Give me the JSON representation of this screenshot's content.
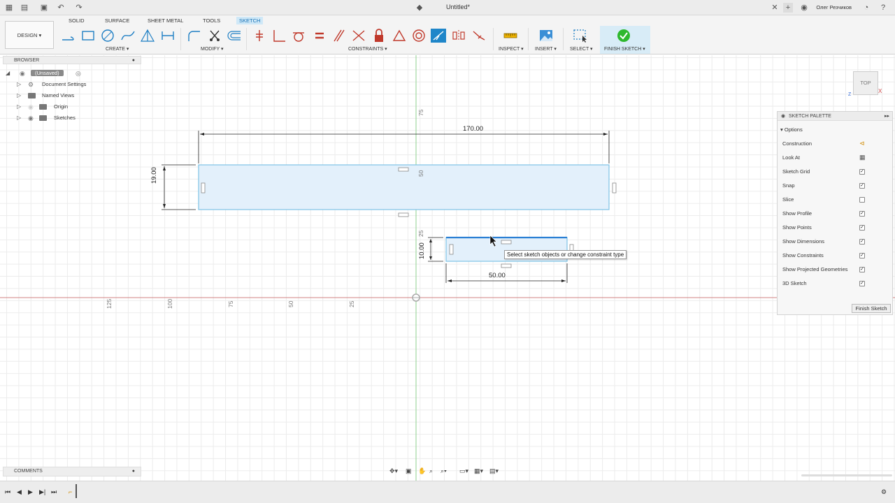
{
  "window": {
    "title": "Untitled*",
    "user": "Олег Резчиков"
  },
  "ribbon": {
    "design_label": "DESIGN",
    "tabs": [
      "SOLID",
      "SURFACE",
      "SHEET METAL",
      "TOOLS",
      "SKETCH"
    ],
    "active_tab": "SKETCH",
    "groups": {
      "create": "CREATE",
      "modify": "MODIFY",
      "constraints": "CONSTRAINTS",
      "inspect": "INSPECT",
      "insert": "INSERT",
      "select": "SELECT",
      "finish": "FINISH SKETCH"
    },
    "finish_color": "#2eb82e"
  },
  "browser": {
    "title": "BROWSER",
    "items": [
      {
        "label": "(Unsaved)"
      },
      {
        "label": "Document Settings"
      },
      {
        "label": "Named Views"
      },
      {
        "label": "Origin"
      },
      {
        "label": "Sketches"
      }
    ]
  },
  "canvas": {
    "dimensions": {
      "width_top": "170.00",
      "height_top": "19.00",
      "height_small": "10.00",
      "width_small": "50.00"
    },
    "axis_labels_x": [
      "125",
      "100",
      "75",
      "50",
      "25"
    ],
    "axis_labels_y": [
      "75",
      "50",
      "25"
    ],
    "tooltip": "Select sketch objects or change constraint type",
    "viewcube_label": "TOP",
    "colors": {
      "profile_fill": "#e3f0fb",
      "profile_stroke": "#7ec3e6",
      "x_axis": "#d08080",
      "y_axis": "#8fd18f"
    }
  },
  "palette": {
    "title": "SKETCH PALETTE",
    "section": "Options",
    "options": [
      {
        "label": "Construction",
        "control": "icon"
      },
      {
        "label": "Look At",
        "control": "icon"
      },
      {
        "label": "Sketch Grid",
        "checked": true
      },
      {
        "label": "Snap",
        "checked": true
      },
      {
        "label": "Slice",
        "checked": false
      },
      {
        "label": "Show Profile",
        "checked": true
      },
      {
        "label": "Show Points",
        "checked": true
      },
      {
        "label": "Show Dimensions",
        "checked": true
      },
      {
        "label": "Show Constraints",
        "checked": true
      },
      {
        "label": "Show Projected Geometries",
        "checked": true
      },
      {
        "label": "3D Sketch",
        "checked": true
      }
    ],
    "finish_button": "Finish Sketch"
  },
  "bottom": {
    "comments": "COMMENTS"
  }
}
